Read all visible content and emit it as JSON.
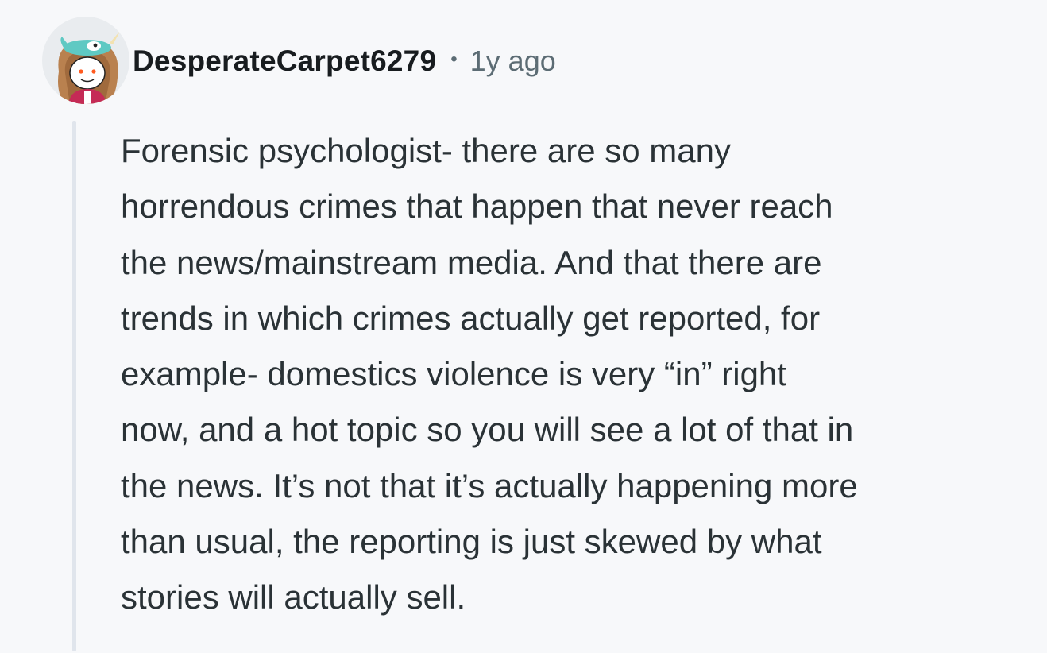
{
  "comment": {
    "author": "DesperateCarpet6279",
    "separator": "•",
    "timestamp": "1y ago",
    "avatar_icon": "snoo-avatar-icon",
    "body_lines": [
      "Forensic psychologist- there are so many",
      "horrendous crimes that happen that never reach",
      "the news/mainstream media. And that there are",
      "trends in which crimes actually get reported, for",
      "example- domestics violence is very “in” right",
      "now, and a hot topic so you will see a lot of that in",
      "the news. It’s not that it’s actually happening more",
      "than usual, the reporting is just skewed by what",
      "stories will actually sell."
    ]
  },
  "colors": {
    "background": "#f7f8fa",
    "text": "#2a3236",
    "username": "#181c1f",
    "meta": "#5c6c74",
    "thread_line": "#e0e5ec"
  }
}
